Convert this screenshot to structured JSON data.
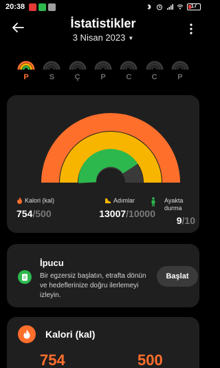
{
  "status_bar": {
    "time": "20:38",
    "battery": "17",
    "app_icon_colors": [
      "#e53935",
      "#2db84d",
      "#9e9e9e"
    ]
  },
  "header": {
    "title": "İstatistikler",
    "date": "3 Nisan 2023",
    "back_icon": "arrow-left-icon",
    "more_icon": "more-vert-icon"
  },
  "week": {
    "days": [
      {
        "label": "P",
        "active": true
      },
      {
        "label": "S",
        "active": false
      },
      {
        "label": "Ç",
        "active": false
      },
      {
        "label": "P",
        "active": false
      },
      {
        "label": "C",
        "active": false
      },
      {
        "label": "C",
        "active": false
      },
      {
        "label": "P",
        "active": false
      }
    ]
  },
  "gauge": {
    "colors": {
      "calories": "#ff6f2c",
      "steps": "#f7b500",
      "stand": "#2db84d",
      "track": "#3a3a3a"
    }
  },
  "metrics": {
    "calories": {
      "label": "Kalori (kal)",
      "value": "754",
      "goal": "/500",
      "icon": "flame-icon"
    },
    "steps": {
      "label": "Adımlar",
      "value": "13007",
      "goal": "/10000",
      "icon": "shoe-icon"
    },
    "stand": {
      "label_line1": "Ayakta",
      "label_line2": "durma",
      "value": "9",
      "goal": "/10",
      "icon": "standing-person-icon"
    }
  },
  "tip": {
    "title": "İpucu",
    "text": "Bir egzersiz başlatın, etrafta dönün ve hedeflerinize doğru ilerlemeyi izleyin.",
    "button": "Başlat",
    "icon": "note-icon"
  },
  "calorie_card": {
    "title": "Kalori (kal)",
    "value": "754",
    "goal": "500",
    "icon": "flame-icon"
  }
}
